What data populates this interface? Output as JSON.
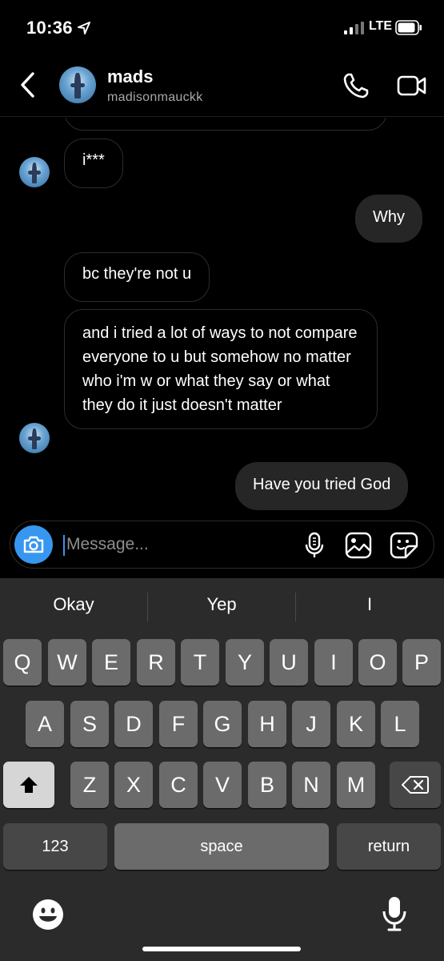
{
  "status_bar": {
    "time": "10:36",
    "network": "LTE"
  },
  "header": {
    "name": "mads",
    "username": "madisonmauckk"
  },
  "messages": [
    {
      "from": "them",
      "text": "i***"
    },
    {
      "from": "me",
      "text": "Why"
    },
    {
      "from": "them",
      "text": "bc they're not u"
    },
    {
      "from": "them",
      "text": "and i tried a lot of ways to not compare everyone to u but somehow no matter who i'm w or what they say or what they do it just doesn't matter"
    },
    {
      "from": "me",
      "text": "Have you tried God"
    }
  ],
  "composer": {
    "placeholder": "Message..."
  },
  "keyboard": {
    "suggestions": [
      "Okay",
      "Yep",
      "I"
    ],
    "row1": [
      "Q",
      "W",
      "E",
      "R",
      "T",
      "Y",
      "U",
      "I",
      "O",
      "P"
    ],
    "row2": [
      "A",
      "S",
      "D",
      "F",
      "G",
      "H",
      "J",
      "K",
      "L"
    ],
    "row3": [
      "Z",
      "X",
      "C",
      "V",
      "B",
      "N",
      "M"
    ],
    "numbers_label": "123",
    "space_label": "space",
    "return_label": "return"
  },
  "colors": {
    "accent": "#3797f0",
    "outgoing_bubble": "#262626",
    "keyboard_bg": "#2b2b2b",
    "key_bg": "#6b6b6b"
  },
  "icons": [
    "location-arrow-icon",
    "signal-icon",
    "battery-icon",
    "back-icon",
    "phone-icon",
    "video-icon",
    "camera-icon",
    "microphone-icon",
    "gallery-icon",
    "sticker-icon",
    "shift-icon",
    "backspace-icon",
    "emoji-icon",
    "dictation-icon"
  ]
}
